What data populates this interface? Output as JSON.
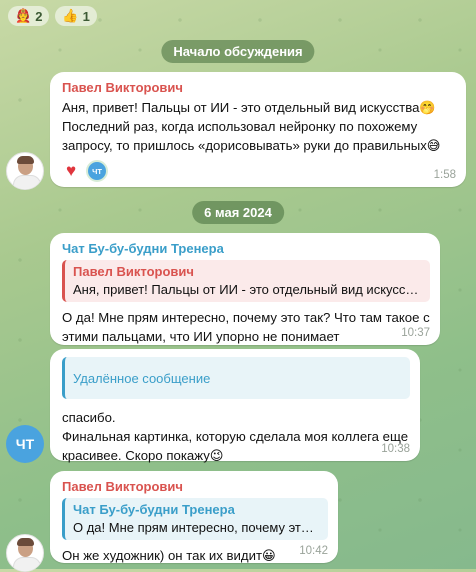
{
  "top_reactions": [
    {
      "icon": "🧑‍🚒",
      "count": "2"
    },
    {
      "icon": "👍",
      "count": "1"
    }
  ],
  "separators": {
    "discussion_start": "Начало обсуждения",
    "date": "6 мая 2024"
  },
  "msg1": {
    "author": "Павел Викторович",
    "text": "Аня, привет! Пальцы от ИИ - это отдельный вид искусства🤭 Последний раз, когда использовал нейронку по похожему запросу, то пришлось «дорисовывать» руки до правильных😅",
    "reactions": {
      "heart": "♥",
      "mini_avatar": "ЧТ"
    },
    "time": "1:58"
  },
  "msg2": {
    "author": "Чат Бу-бу-будни Тренера",
    "quote_author": "Павел Викторович",
    "quote_text": "Аня, привет! Пальцы от ИИ - это отдельный вид искусства🤭",
    "text": "О да! Мне прям интересно, почему это так? Что там такое с этими пальцами, что ИИ упорно не понимает",
    "time": "10:37"
  },
  "msg3": {
    "deleted_label": "Удалённое сообщение",
    "text": "спасибо.\nФинальная картинка, которую сделала моя коллега еще красивее. Скоро покажу😉",
    "time": "10:38",
    "avatar": "ЧТ"
  },
  "msg4": {
    "author": "Павел Викторович",
    "quote_author": "Чат Бу-бу-будни Тренера",
    "quote_text": "О да! Мне прям интересно, почему это так? Что там такое с этими пальцами",
    "text": "Он же художник) он так их видит😀",
    "time": "10:42"
  },
  "colors": {
    "author_red": "#d9534f",
    "author_blue": "#3a9ec9",
    "quote_red_bg": "#fbeaea",
    "quote_blue_bg": "#e8f4f8"
  }
}
